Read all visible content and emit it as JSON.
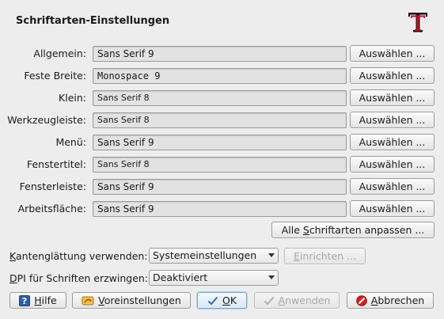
{
  "window": {
    "title": "Schriftarten-Einstellungen",
    "logo_icon": "font-T-icon"
  },
  "fonts": [
    {
      "label": "Allgemein:",
      "value": "Sans Serif 9",
      "button": "Auswählen ..."
    },
    {
      "label": "Feste Breite:",
      "value": "Monospace 9",
      "button": "Auswählen ..."
    },
    {
      "label": "Klein:",
      "value": "Sans Serif 8",
      "button": "Auswählen ..."
    },
    {
      "label": "Werkzeugleiste:",
      "value": "Sans Serif 8",
      "button": "Auswählen ..."
    },
    {
      "label": "Menü:",
      "value": "Sans Serif 9",
      "button": "Auswählen ..."
    },
    {
      "label": "Fenstertitel:",
      "value": "Sans Serif 8",
      "button": "Auswählen ..."
    },
    {
      "label": "Fensterleiste:",
      "value": "Sans Serif 9",
      "button": "Auswählen ..."
    },
    {
      "label": "Arbeitsfläche:",
      "value": "Sans Serif 9",
      "button": "Auswählen ..."
    }
  ],
  "adjust_all": {
    "pre": "Alle ",
    "accel": "S",
    "post": "chriftarten anpassen ..."
  },
  "antialias": {
    "accel": "K",
    "label_rest": "antenglättung verwenden:",
    "value": "Systemeinstellungen",
    "configure_pre": "",
    "configure_accel": "E",
    "configure_post": "inrichten ..."
  },
  "dpi": {
    "accel": "D",
    "label_rest": "PI für Schriften erzwingen:",
    "value": "Deaktiviert"
  },
  "buttons": {
    "help": {
      "accel": "H",
      "rest": "ilfe"
    },
    "defaults": {
      "accel": "V",
      "rest": "oreinstellungen"
    },
    "ok": {
      "accel": "O",
      "rest": "K"
    },
    "apply": {
      "pre": "",
      "accel": "A",
      "rest": "nwenden"
    },
    "cancel": {
      "accel": "A",
      "rest": "bbrechen"
    }
  },
  "colors": {
    "background": "#ededed",
    "logo_red": "#c8102e",
    "help_blue": "#2f5fa8",
    "cancel_red": "#d42020",
    "ok_check": "#3b6ea8"
  }
}
